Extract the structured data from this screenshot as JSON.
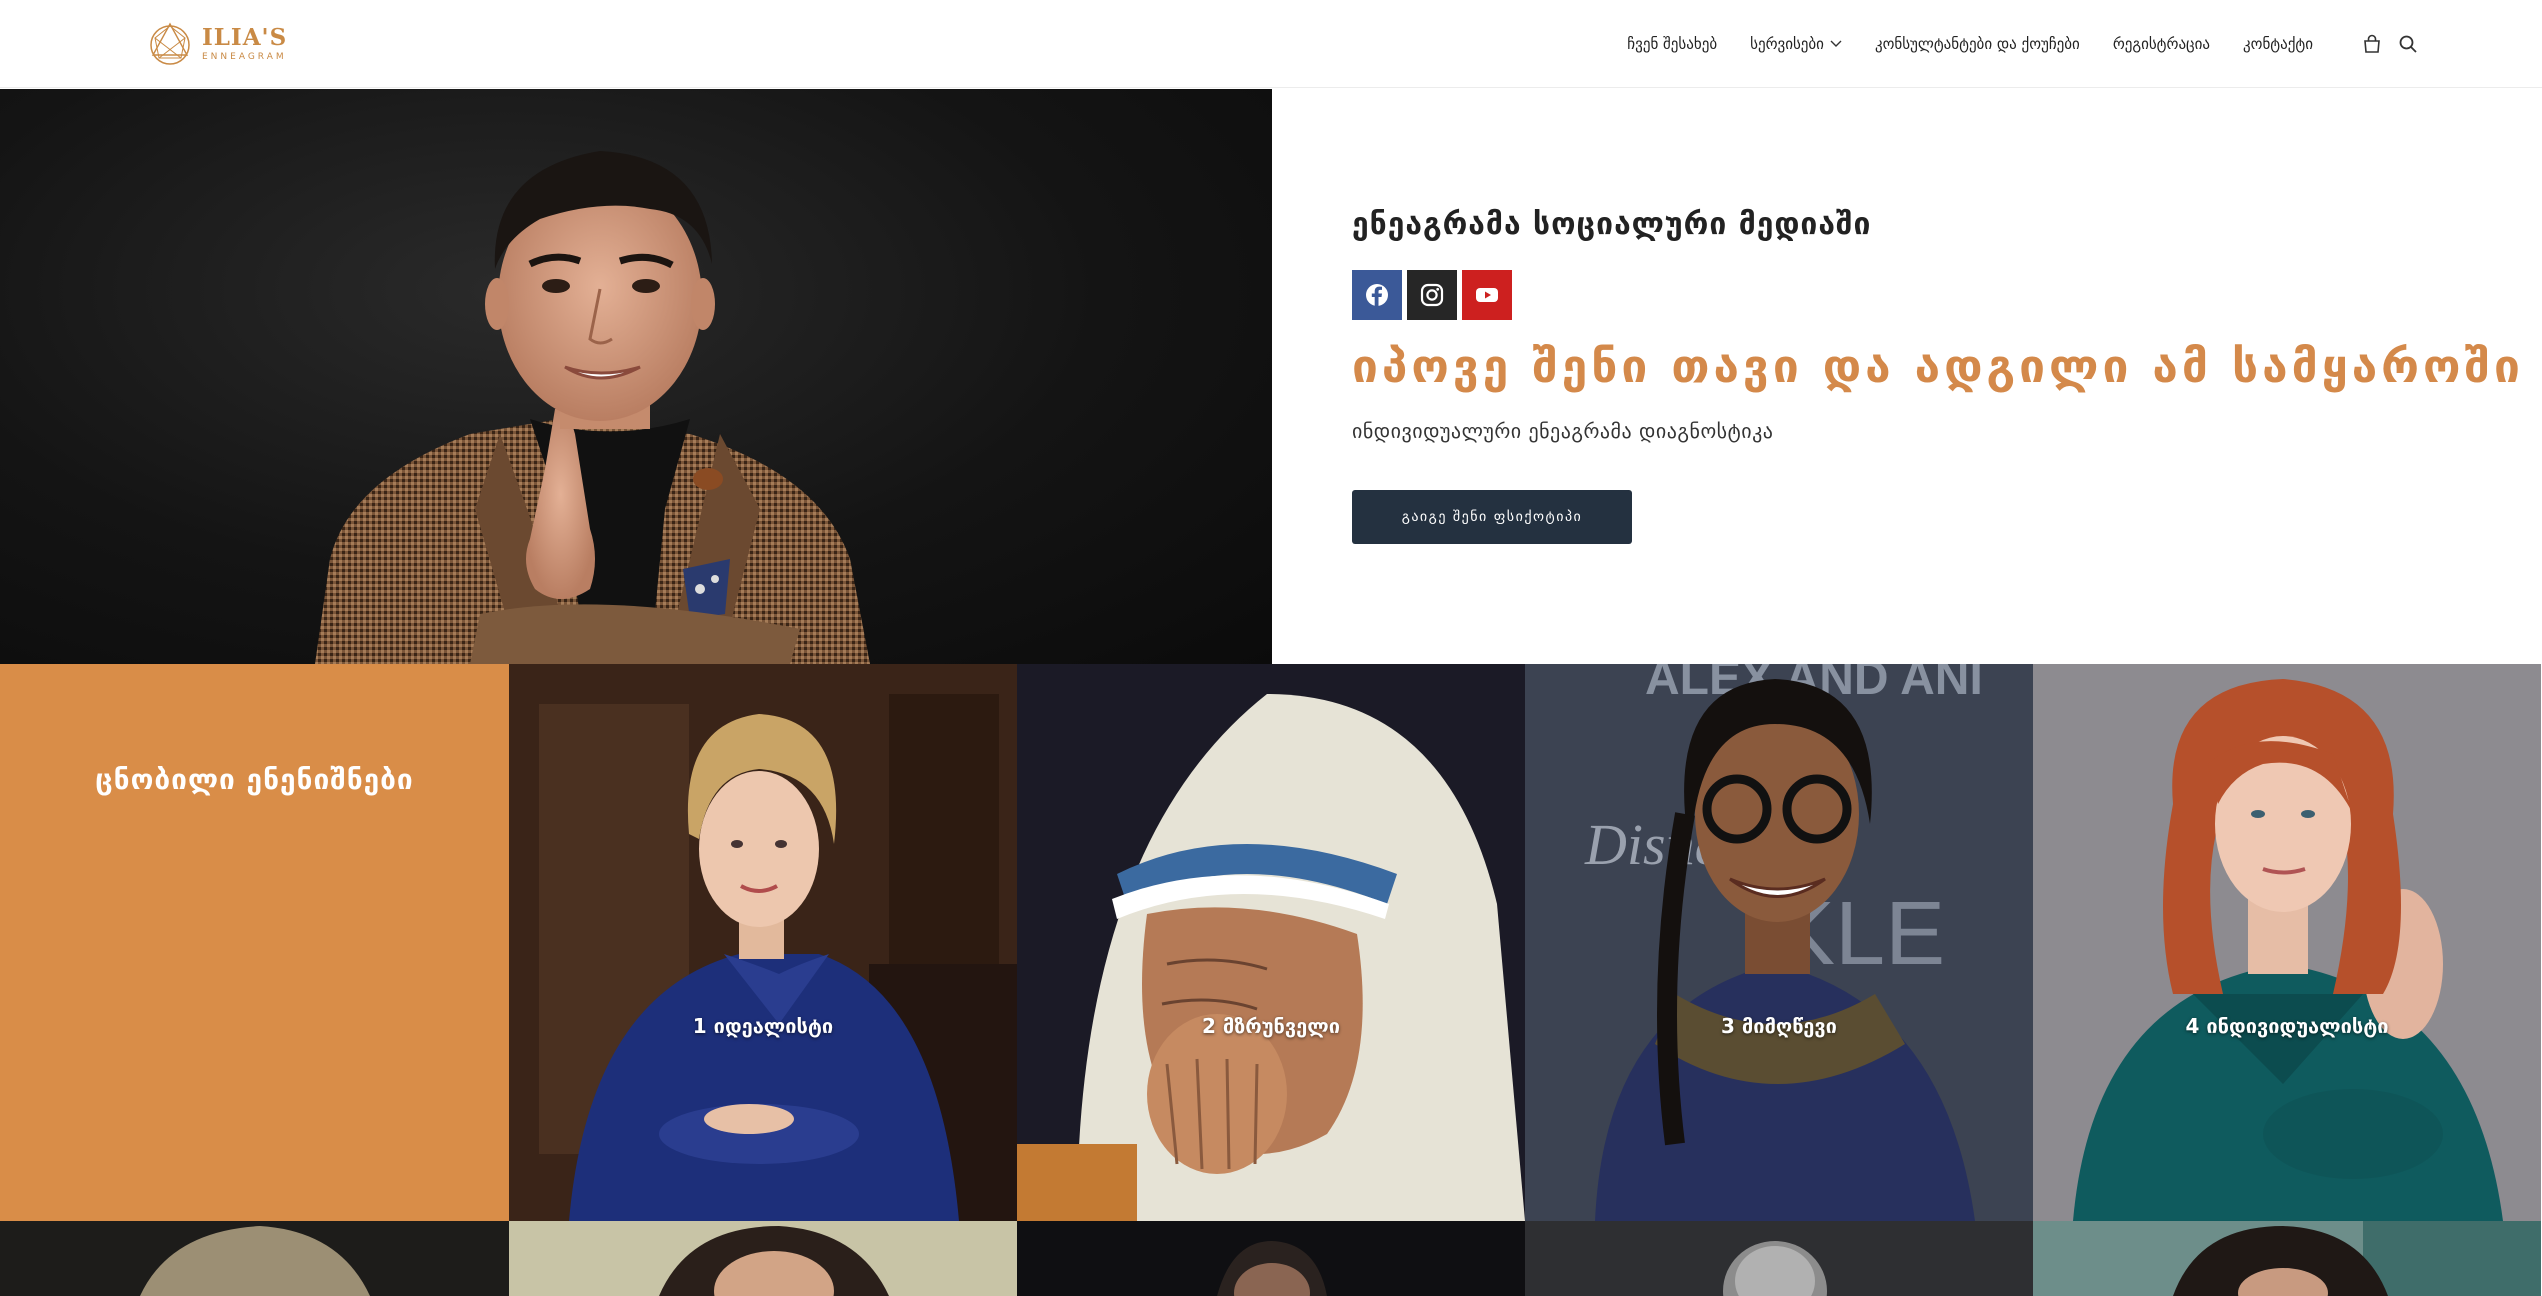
{
  "header": {
    "logo": {
      "title": "ILIA'S",
      "subtitle": "ENNEAGRAM"
    },
    "nav": [
      {
        "label": "ჩვენ შესახებ",
        "has_dropdown": false
      },
      {
        "label": "სერვისები",
        "has_dropdown": true
      },
      {
        "label": "კონსულტანტები და ქოუჩები",
        "has_dropdown": false
      },
      {
        "label": "რეგისტრაცია",
        "has_dropdown": false
      },
      {
        "label": "კონტაქტი",
        "has_dropdown": false
      }
    ],
    "icons": [
      "cart-icon",
      "search-icon"
    ]
  },
  "hero": {
    "social_title": "ენეაგრამა სოციალური მედიაში",
    "social": [
      {
        "name": "facebook-icon",
        "color": "#3b5998"
      },
      {
        "name": "instagram-icon",
        "color": "#262626"
      },
      {
        "name": "youtube-icon",
        "color": "#cd201f"
      }
    ],
    "headline": "იპოვე შენი თავი და ადგილი ამ სამყაროში",
    "subtitle": "ინდივიდუალური ენეაგრამა დიაგნოსტიკა",
    "cta_label": "გაიგე შენი ფსიქოტიპი"
  },
  "famous": {
    "title": "ცნობილი ენენიშნები",
    "cards": [
      {
        "label": "1 იდეალისტი"
      },
      {
        "label": "2 მზრუნველი"
      },
      {
        "label": "3 მიმღწევი"
      },
      {
        "label": "4 ინდივიდუალისტი"
      }
    ]
  },
  "colors": {
    "accent": "#d98d48",
    "headline": "#d4894a",
    "cta_bg": "#243140",
    "logo": "#c98a45"
  }
}
